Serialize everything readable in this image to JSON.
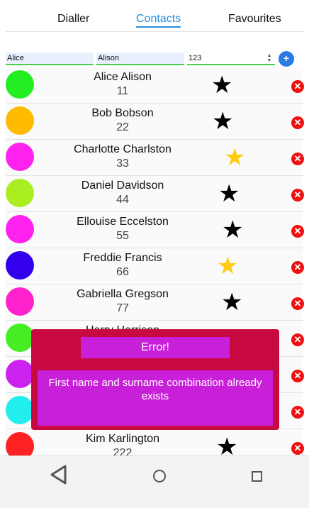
{
  "tabs": [
    {
      "label": "Dialler"
    },
    {
      "label": "Contacts"
    },
    {
      "label": "Favourites"
    }
  ],
  "form": {
    "first_name": "Alice",
    "surname": "Alison",
    "age": "123",
    "add_label": "+"
  },
  "contacts": [
    {
      "name": "Alice Alison",
      "age": "11",
      "color": "#22ee22",
      "favourite": false
    },
    {
      "name": "Bob Bobson",
      "age": "22",
      "color": "#ffbb00",
      "favourite": false
    },
    {
      "name": "Charlotte Charlston",
      "age": "33",
      "color": "#ff22ee",
      "favourite": true
    },
    {
      "name": "Daniel Davidson",
      "age": "44",
      "color": "#aaee22",
      "favourite": false
    },
    {
      "name": "Ellouise Eccelston",
      "age": "55",
      "color": "#ff22ee",
      "favourite": false
    },
    {
      "name": "Freddie Francis",
      "age": "66",
      "color": "#3300ee",
      "favourite": true
    },
    {
      "name": "Gabriella Gregson",
      "age": "77",
      "color": "#ff22cc",
      "favourite": false
    },
    {
      "name": "Harry Harrison",
      "age": "",
      "color": "#44ee22",
      "favourite": false
    },
    {
      "name": "",
      "age": "",
      "color": "#cc22ee",
      "favourite": false
    },
    {
      "name": "",
      "age": "",
      "color": "#22eeee",
      "favourite": false
    },
    {
      "name": "Kim Karlington",
      "age": "222",
      "color": "#ff2222",
      "favourite": false
    }
  ],
  "dialog": {
    "title": "Error!",
    "message": "First name and surname combination already exists"
  },
  "icons": {
    "star": "★",
    "delete": "✕",
    "back": "back-triangle-icon",
    "home": "home-circle-icon",
    "recent": "recent-square-icon"
  },
  "colors": {
    "accent": "#2a8ed8",
    "star_favourite": "#ffcc11",
    "star_normal": "#000000",
    "dialog_bg": "#c8093f",
    "dialog_panel": "#c81fd8"
  }
}
